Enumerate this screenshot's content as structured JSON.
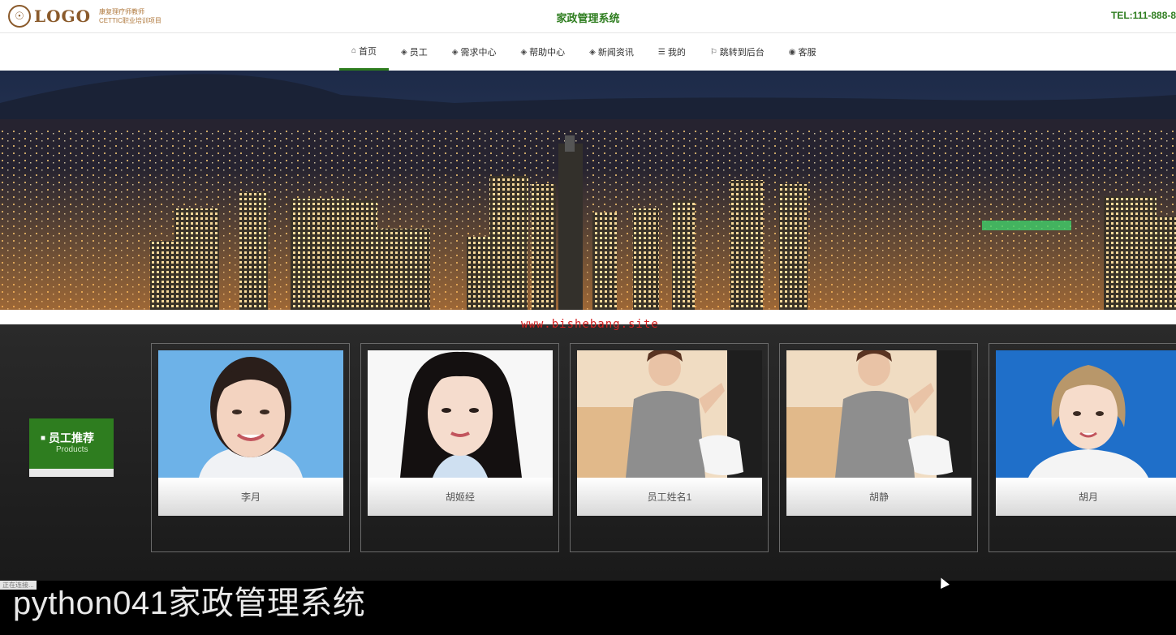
{
  "header": {
    "logo_text": "LOGO",
    "logo_sub1": "康复理疗师教师",
    "logo_sub2": "CETTIC职业培训项目",
    "site_title": "家政管理系统",
    "tel": "TEL:111-888-8"
  },
  "nav": {
    "items": [
      {
        "label": "首页",
        "icon": "home-icon"
      },
      {
        "label": "员工",
        "icon": "stack-icon"
      },
      {
        "label": "需求中心",
        "icon": "stack-icon"
      },
      {
        "label": "帮助中心",
        "icon": "stack-icon"
      },
      {
        "label": "新闻资讯",
        "icon": "stack-icon"
      },
      {
        "label": "我的",
        "icon": "list-icon"
      },
      {
        "label": "跳转到后台",
        "icon": "flag-icon"
      },
      {
        "label": "客服",
        "icon": "chat-icon"
      }
    ],
    "active_index": 0
  },
  "watermark": "www.bishebang.site",
  "section": {
    "title": "员工推荐",
    "subtitle": "Products"
  },
  "employees": [
    {
      "name": "李月"
    },
    {
      "name": "胡姬经"
    },
    {
      "name": "员工姓名1"
    },
    {
      "name": "胡静"
    },
    {
      "name": "胡月"
    }
  ],
  "status_text": "正在连接...",
  "caption": "python041家政管理系统",
  "colors": {
    "accent": "#2e7d1f",
    "watermark": "#d42020"
  }
}
